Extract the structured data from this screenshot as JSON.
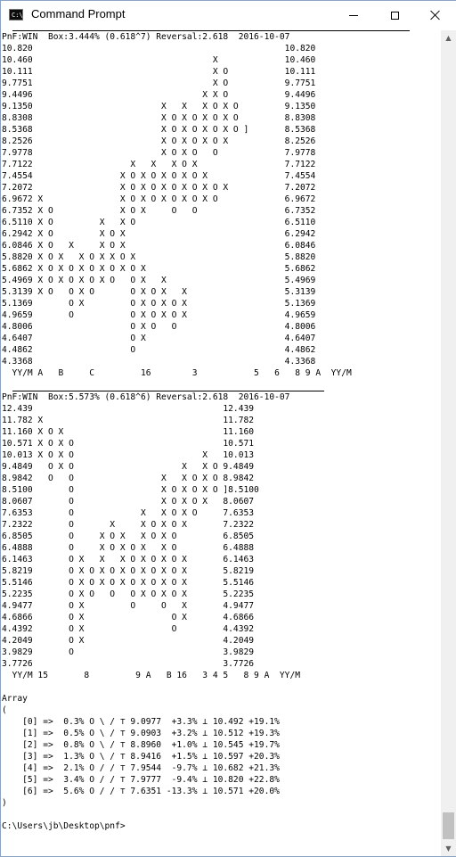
{
  "window": {
    "title": "Command Prompt",
    "icon_text": "C:\\",
    "icon": "cmd-icon"
  },
  "controls": {
    "minimize": "minimize-icon",
    "maximize": "maximize-icon",
    "close": "close-icon"
  },
  "console": {
    "chart1_lines": [
      "PnF:WIN  Box:3.444% (0.618^7) Reversal:2.618  2016-10-07",
      "10.820                                                 10.820",
      "10.460                                   X             10.460",
      "10.111                                   X O           10.111",
      "9.7751                                   X O           9.7751",
      "9.4496                                 X X O           9.4496",
      "9.1350                         X   X   X O X O         9.1350",
      "8.8308                         X O X O X O X O         8.8308",
      "8.5368                         X O X O X O X O ]       8.5368",
      "8.2526                         X O X O X O X           8.2526",
      "7.9778                         X O X O   O             7.9778",
      "7.7122                   X   X   X O X                 7.7122",
      "7.4554                 X O X O X O X O X               7.4554",
      "7.2072                 X O X O X O X O X O X           7.2072",
      "6.9672 X               X O X O X O X O X O             6.9672",
      "6.7352 X O             X O X     O   O                 6.7352",
      "6.5110 X O         X   X O                             6.5110",
      "6.2942 X O         X O X                               6.2942",
      "6.0846 X O   X     X O X                               6.0846",
      "5.8820 X O X   X O X X O X                             5.8820",
      "5.6862 X O X O X O X O X O X                           5.6862",
      "5.4969 X O X O X O X O   O X   X                       5.4969",
      "5.3139 X O   O X O       O X O X   X                   5.3139",
      "5.1369       O X         O X O X O X                   5.1369",
      "4.9659       O           O X O X O X                   4.9659",
      "4.8006                   O X O   O                     4.8006",
      "4.6407                   O X                           4.6407",
      "4.4862                   O                             4.4862",
      "4.3368                                                 4.3368",
      "  YY/M A   B     C         16        3           5   6   8 9 A  YY/M"
    ],
    "chart2_lines": [
      "PnF:WIN  Box:5.573% (0.618^6) Reversal:2.618  2016-10-07",
      "12.439                                     12.439",
      "11.782 X                                   11.782",
      "11.160 X O X                               11.160",
      "10.571 X O X O                             10.571",
      "10.013 X O X O                         X   10.013",
      "9.4849   O X O                     X   X O 9.4849",
      "8.9842   O   O                 X   X O X O 8.9842",
      "8.5100       O                 X O X O X O ]8.5100",
      "8.0607       O                 X O X O X   8.0607",
      "7.6353       O             X   X O X O     7.6353",
      "7.2322       O       X     X O X O X       7.2322",
      "6.8505       O     X O X   X O X O         6.8505",
      "6.4888       O     X O X O X   X O         6.4888",
      "6.1463       O X   X   X O X O X O X       6.1463",
      "5.8219       O X O X O X O X O X O X       5.8219",
      "5.5146       O X O X O X O X O X O X       5.5146",
      "5.2235       O X O   O   O X O X O X       5.2235",
      "4.9477       O X         O     O   X       4.9477",
      "4.6866       O X                 O X       4.6866",
      "4.4392       O X                 O         4.4392",
      "4.2049       O X                           4.2049",
      "3.9829       O                             3.9829",
      "3.7726                                     3.7726",
      "  YY/M 15       8         9 A   B 16   3 4 5   8 9 A  YY/M"
    ],
    "array_lines": [
      "",
      "Array",
      "(",
      "    [0] =>  0.3% O \\ / ⊤ 9.0977  +3.3% ⊥ 10.492 +19.1%",
      "    [1] =>  0.5% O \\ / ⊤ 9.0903  +3.2% ⊥ 10.512 +19.3%",
      "    [2] =>  0.8% O \\ / ⊤ 8.8960  +1.0% ⊥ 10.545 +19.7%",
      "    [3] =>  1.3% O \\ / ⊤ 8.9416  +1.5% ⊥ 10.597 +20.3%",
      "    [4] =>  2.1% O / / ⊤ 7.9544  -9.7% ⊥ 10.682 +21.3%",
      "    [5] =>  3.4% O / / ⊤ 7.9777  -9.4% ⊥ 10.820 +22.8%",
      "    [6] =>  5.6% O / / ⊤ 7.6351 -13.3% ⊥ 10.571 +20.0%",
      ")",
      "",
      "C:\\Users\\jb\\Desktop\\pnf>"
    ]
  },
  "scrollbar": {
    "up_arrow": "▲",
    "down_arrow": "▼",
    "position": 0.95
  }
}
